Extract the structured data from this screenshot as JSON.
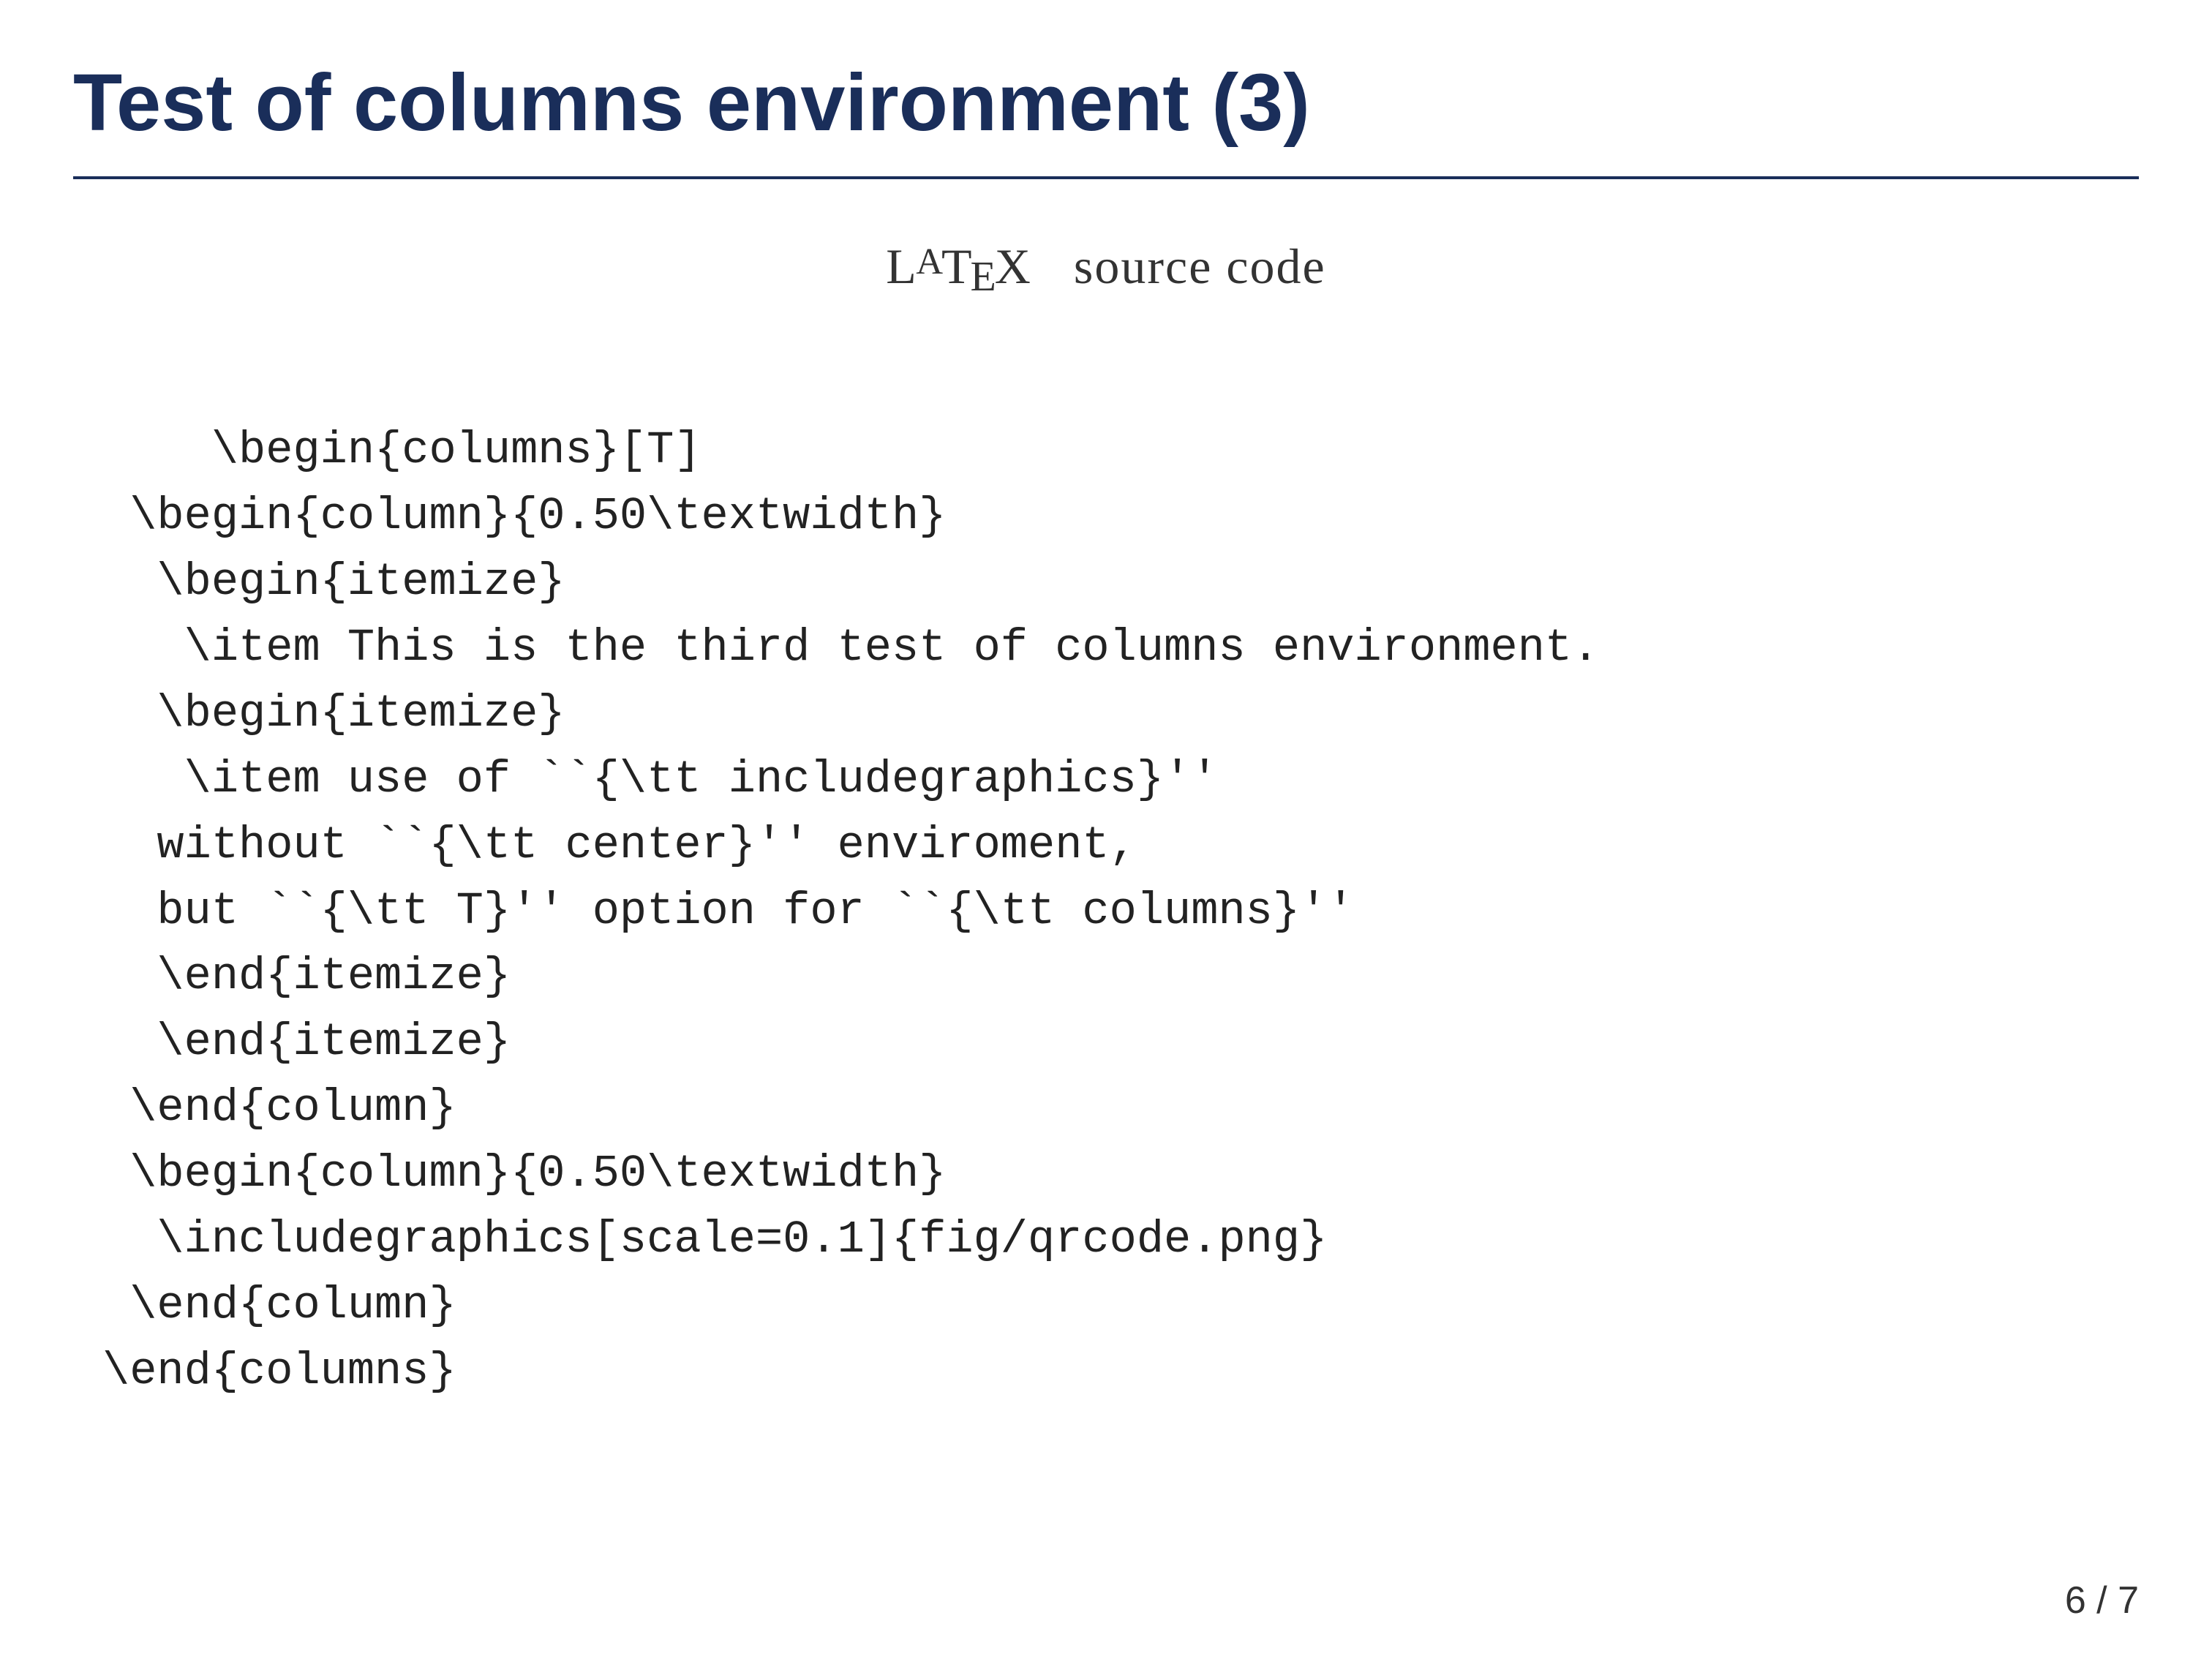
{
  "slide": {
    "title": "Test of columns environment (3)",
    "subtitle_prefix": "L",
    "subtitle_middle": "A",
    "subtitle_tex": "T",
    "subtitle_e": "E",
    "subtitle_x": "X",
    "subtitle_suffix": "  source code",
    "code_lines": [
      "\\begin{columns}[T]",
      " \\begin{column}{0.50\\textwidth}",
      "  \\begin{itemize}",
      "   \\item This is the third test of columns environment.",
      "  \\begin{itemize}",
      "   \\item use of ``{\\tt includegraphics}''",
      "  without ``{\\tt center}'' enviroment,",
      "  but ``{\\tt T}'' option for ``{\\tt columns}''",
      "  \\end{itemize}",
      "  \\end{itemize}",
      " \\end{column}",
      " \\begin{column}{0.50\\textwidth}",
      "  \\includegraphics[scale=0.1]{fig/qrcode.png}",
      " \\end{column}",
      "\\end{columns}"
    ],
    "page_number": "6 / 7"
  }
}
